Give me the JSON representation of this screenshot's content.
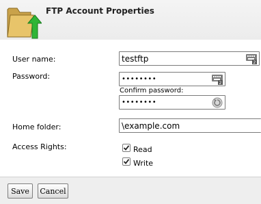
{
  "header": {
    "title": "FTP Account Properties",
    "icon": "ftp-folder-upload-icon"
  },
  "form": {
    "username": {
      "label": "User name:",
      "value": "testftp",
      "icon": "keyboard-icon"
    },
    "password": {
      "label": "Password:",
      "value": "••••••••",
      "icon": "keyboard-icon"
    },
    "confirm_password": {
      "label": "Confirm password:",
      "value": "••••••••",
      "icon": "password-match-icon"
    },
    "home_folder": {
      "label": "Home folder:",
      "value": "\\example.com"
    },
    "access_rights": {
      "label": "Access Rights:",
      "read": {
        "label": "Read",
        "checked": true
      },
      "write": {
        "label": "Write",
        "checked": true
      }
    }
  },
  "buttons": {
    "save": "Save",
    "cancel": "Cancel"
  }
}
